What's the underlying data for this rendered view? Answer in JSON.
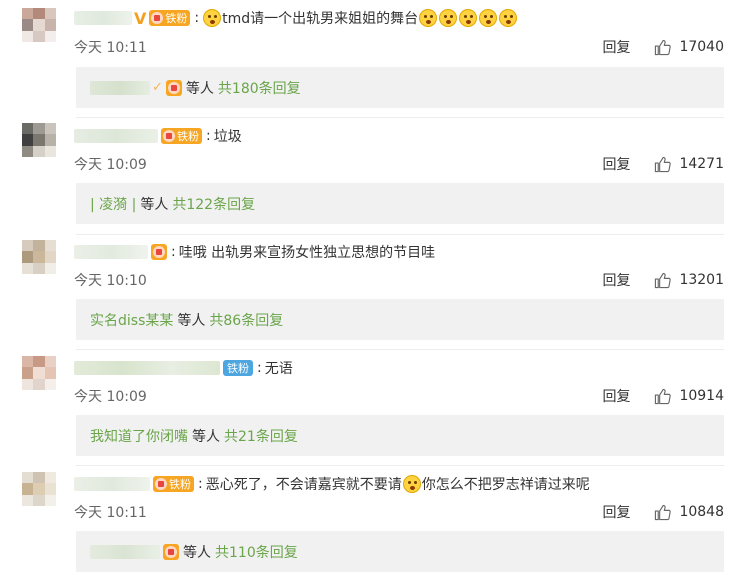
{
  "comments": [
    {
      "text": "tmd请一个出轨男来姐姐的舞台",
      "time": "今天 10:11",
      "likes": "17040",
      "reply_label": "回复",
      "badge": "铁粉",
      "replies_user": "",
      "replies_waits": "等人",
      "replies_total": "共180条回复"
    },
    {
      "text": "垃圾",
      "time": "今天 10:09",
      "likes": "14271",
      "reply_label": "回复",
      "badge": "铁粉",
      "replies_user": "| 凌漪 |",
      "replies_waits": "等人",
      "replies_total": "共122条回复"
    },
    {
      "text": "哇哦 出轨男来宣扬女性独立思想的节目哇",
      "time": "今天 10:10",
      "likes": "13201",
      "reply_label": "回复",
      "replies_user": "实名diss某某",
      "replies_waits": "等人",
      "replies_total": "共86条回复"
    },
    {
      "text": "无语",
      "time": "今天 10:09",
      "likes": "10914",
      "reply_label": "回复",
      "badge": "铁粉",
      "replies_user": "我知道了你闭嘴",
      "replies_waits": "等人",
      "replies_total": "共21条回复"
    },
    {
      "text_a": "恶心死了，不会请嘉宾就不要请",
      "text_b": "你怎么不把罗志祥请过来呢",
      "time": "今天 10:11",
      "likes": "10848",
      "reply_label": "回复",
      "badge": "铁粉",
      "replies_user": "",
      "replies_waits": "等人",
      "replies_total": "共110条回复"
    }
  ],
  "colors": {
    "link_green": "#6aa54a",
    "badge_orange": "#f6a623",
    "badge_blue": "#4da6e0"
  },
  "icons": {
    "like": "thumb-up-icon",
    "emoji": "surprised-face-emoji"
  }
}
